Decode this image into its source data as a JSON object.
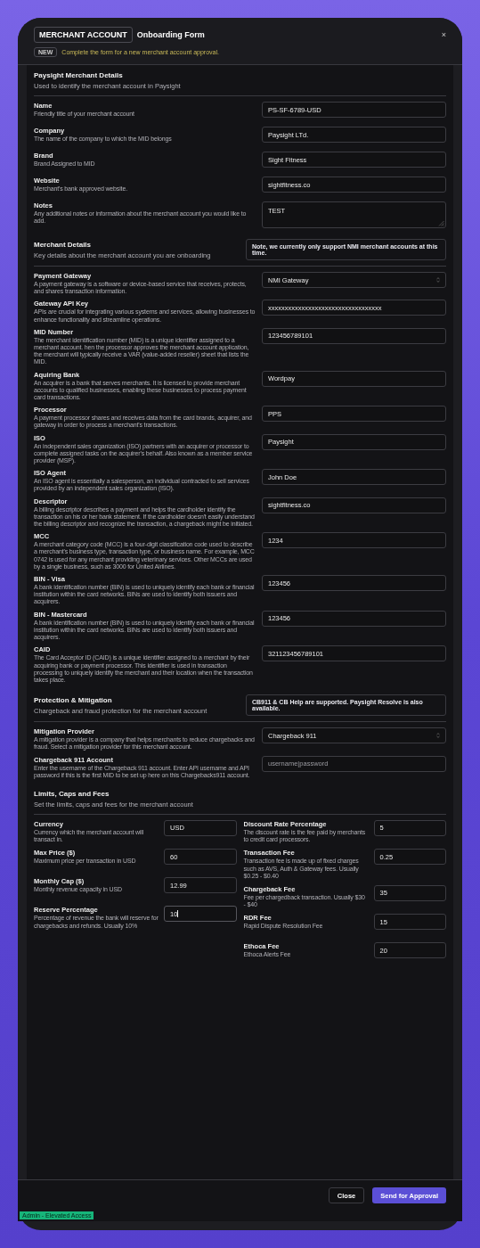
{
  "header": {
    "badge": "MERCHANT ACCOUNT",
    "title": "Onboarding Form",
    "tag": "NEW",
    "subtitle": "Complete the form for a new merchant account approval.",
    "close": "×"
  },
  "sections": [
    {
      "title": "Paysight Merchant Details",
      "subtitle": "Used to identify the merchant account in Paysight",
      "fields": [
        {
          "kind": "input",
          "label": "Name",
          "description": "Friendly title of your merchant account",
          "value": "PS-SF-6789-USD"
        },
        {
          "kind": "input",
          "label": "Company",
          "description": "The name of the company to which the MID belongs",
          "value": "Paysight LTd."
        },
        {
          "kind": "input",
          "label": "Brand",
          "description": "Brand Assigned to MID",
          "value": "Sight Fitness"
        },
        {
          "kind": "input",
          "label": "Website",
          "description": "Merchant's bank approved website.",
          "value": "sightfitness.co"
        },
        {
          "kind": "textarea",
          "label": "Notes",
          "description": "Any additional notes or information about the merchant account you would like to add.",
          "value": "TEST"
        }
      ]
    },
    {
      "title": "Merchant Details",
      "subtitle": "Key details about the merchant account you are onboarding",
      "note": "Note, we currently only support NMI merchant accounts at this time.",
      "fields": [
        {
          "kind": "select",
          "label": "Payment Gateway",
          "description": "A payment gateway is a software or device-based service that receives, protects, and shares transaction information.",
          "value": "NMI Gateway"
        },
        {
          "kind": "input",
          "label": "Gateway API Key",
          "description": "APIs are crucial for integrating various systems and services, allowing businesses to enhance functionality and streamline operations.",
          "value": "xxxxxxxxxxxxxxxxxxxxxxxxxxxxxxxxxx"
        },
        {
          "kind": "input",
          "label": "MID Number",
          "description": "The merchant identification number (MID) is a unique identifier assigned to a merchant account. hen the processor approves the merchant account application, the merchant will typically receive a VAR (value-added reseller) sheet that lists the MID.",
          "value": "123456789101"
        },
        {
          "kind": "input",
          "label": "Aquiring Bank",
          "description": "An acquirer is a bank that serves merchants. It is licensed to provide merchant accounts to qualified businesses, enabling these businesses to process payment card transactions.",
          "value": "Wordpay"
        },
        {
          "kind": "input",
          "label": "Processor",
          "description": "A payment processor shares and receives data from the card brands, acquirer, and gateway in order to process a merchant's transactions.",
          "value": "PPS"
        },
        {
          "kind": "input",
          "label": "ISO",
          "description": "An independent sales organization (ISO) partners with an acquirer or processor to complete assigned tasks on the acquirer's behalf. Also known as a member service provider (MSP).",
          "value": "Paysight"
        },
        {
          "kind": "input",
          "label": "ISO Agent",
          "description": "An ISO agent is essentially a salesperson, an individual contracted to sell services provided by an independent sales organization (ISO).",
          "value": "John Doe"
        },
        {
          "kind": "input",
          "label": "Descriptor",
          "description": "A billing descriptor describes a payment and helps the cardholder identify the transaction on his or her bank statement. If the cardholder doesn't easily understand the billing descriptor and recognize the transaction, a chargeback might be initiated.",
          "value": "sightfitness.co"
        },
        {
          "kind": "input",
          "label": "MCC",
          "description": "A merchant category code (MCC) is a four-digit classification code used to describe a merchant's business type, transaction type, or business name. For example, MCC 0742 is used for any merchant providing veterinary services. Other MCCs are used by a single business, such as 3000 for United Airlines.",
          "value": "1234"
        },
        {
          "kind": "input",
          "label": "BIN - Visa",
          "description": "A bank identification number (BIN) is used to uniquely identify each bank or financial institution within the card networks. BINs are used to identify both issuers and acquirers.",
          "value": "123456"
        },
        {
          "kind": "input",
          "label": "BIN - Mastercard",
          "description": "A bank identification number (BIN) is used to uniquely identify each bank or financial institution within the card networks. BINs are used to identify both issuers and acquirers.",
          "value": "123456"
        },
        {
          "kind": "input",
          "label": "CAID",
          "description": "The Card Acceptor ID (CAID) is a unique identifier assigned to a merchant by their acquiring bank or payment processor. This identifier is used in transaction processing to uniquely identify the merchant and their location when the transaction takes place.",
          "value": "321123456789101"
        }
      ]
    },
    {
      "title": "Protection & Mitigation",
      "subtitle": "Chargeback and fraud protection for the merchant account",
      "note": "CB911 & CB Help are supported. Paysight Resolve is also available.",
      "fields": [
        {
          "kind": "select",
          "label": "Mitigation Provider",
          "description": "A mitigation provider is a company that helps merchants to reduce chargebacks and fraud. Select a mitigation provider for this merchant account.",
          "value": "Chargeback 911"
        },
        {
          "kind": "input",
          "label": "Chargeback 911 Account",
          "description": "Enter the username of the Chargeback 911 account. Enter API username and API password if this is the first MID to be set up here on this Chargebacks911 account.",
          "placeholder": "username|password"
        }
      ]
    }
  ],
  "limits": {
    "title": "Limits, Caps and Fees",
    "subtitle": "Set the limits, caps and fees for the merchant account",
    "columns": [
      [
        {
          "label": "Currency",
          "description": "Currency which the merchant account will transact in.",
          "value": "USD",
          "focused": false
        },
        {
          "label": "Max Price ($)",
          "description": "Maximum price per transaction in USD",
          "value": "60",
          "focused": false
        },
        {
          "label": "Monthly Cap ($)",
          "description": "Monthly revenue capacity in USD",
          "value": "12.99",
          "focused": false
        },
        {
          "label": "Reserve Percentage",
          "description": "Percentage of revenue the bank will reserve for chargebacks and refunds. Usually 10%",
          "value": "10",
          "focused": true
        }
      ],
      [
        {
          "label": "Discount Rate Percentage",
          "description": "The discount rate is the fee paid by merchants to credit card processors.",
          "value": "5",
          "focused": false
        },
        {
          "label": "Transaction Fee",
          "description": "Transaction fee is made up of fixed charges such as AVS, Auth & Gateway fees. Usually $0.25 - $0.40",
          "value": "0.25",
          "focused": false
        },
        {
          "label": "Chargeback Fee",
          "description": "Fee per chargedback transaction. Usually $30 - $40",
          "value": "35",
          "focused": false
        },
        {
          "label": "RDR Fee",
          "description": "Rapid Dispute Resolution Fee",
          "value": "15",
          "focused": false
        },
        {
          "label": "Ethoca Fee",
          "description": "Ethoca Alerts Fee",
          "value": "20",
          "focused": false
        }
      ]
    ]
  },
  "footer": {
    "buttons": [
      {
        "label": "Close",
        "kind": "secondary"
      },
      {
        "label": "Send for Approval",
        "kind": "primary"
      }
    ],
    "access_badge": "Admin - Elevated Access"
  }
}
